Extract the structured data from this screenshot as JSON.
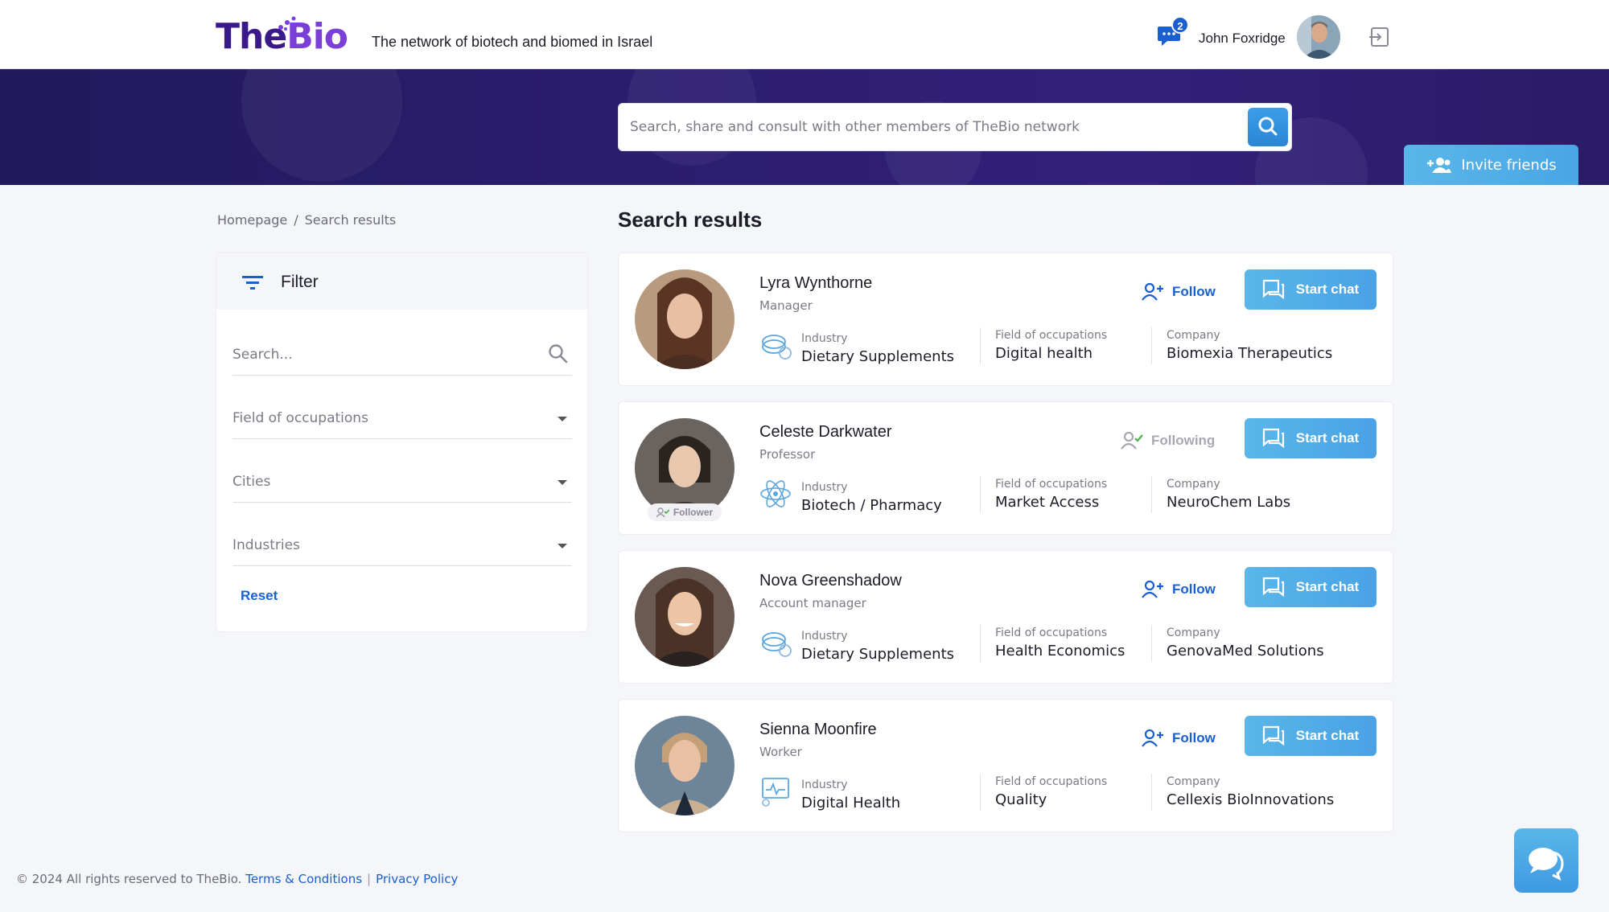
{
  "header": {
    "logo_the": "The",
    "logo_bio": "Bio",
    "tagline": "The network of biotech and biomed in Israel",
    "messages_count": "2",
    "user_name": "John Foxridge"
  },
  "hero": {
    "search_placeholder": "Search, share and consult with other members of TheBio network",
    "invite_label": "Invite friends"
  },
  "breadcrumb": {
    "home": "Homepage",
    "separator": "/",
    "current": "Search results"
  },
  "filter": {
    "title": "Filter",
    "search_placeholder": "Search...",
    "field_of_occupations": "Field of occupations",
    "cities": "Cities",
    "industries": "Industries",
    "reset": "Reset"
  },
  "results": {
    "title": "Search results",
    "labels": {
      "industry": "Industry",
      "field": "Field of occupations",
      "company": "Company",
      "start_chat": "Start chat",
      "follower": "Follower"
    },
    "items": [
      {
        "name": "Lyra Wynthorne",
        "role": "Manager",
        "industry": "Dietary Supplements",
        "field": "Digital health",
        "company": "Biomexia Therapeutics",
        "follow_label": "Follow",
        "industry_icon": "supplements-icon"
      },
      {
        "name": "Celeste Darkwater",
        "role": "Professor",
        "industry": "Biotech / Pharmacy",
        "field": "Market Access",
        "company": "NeuroChem Labs",
        "follow_label": "Following",
        "industry_icon": "atom-icon"
      },
      {
        "name": "Nova Greenshadow",
        "role": "Account manager",
        "industry": "Dietary Supplements",
        "field": "Health Economics",
        "company": "GenovaMed Solutions",
        "follow_label": "Follow",
        "industry_icon": "supplements-icon"
      },
      {
        "name": "Sienna Moonfire",
        "role": "Worker",
        "industry": "Digital Health",
        "field": "Quality",
        "company": "Cellexis BioInnovations",
        "follow_label": "Follow",
        "industry_icon": "digital-health-icon"
      }
    ]
  },
  "footer": {
    "copyright": "© 2024 All rights reserved to TheBio.",
    "terms": "Terms & Conditions",
    "separator": "|",
    "privacy": "Privacy Policy"
  },
  "colors": {
    "brand_primary": "#3a1a8a",
    "brand_accent": "#7a3fd6",
    "link": "#1a5fd0",
    "button": "#4aa6e4",
    "hero_bg": "#2b1d6e"
  }
}
